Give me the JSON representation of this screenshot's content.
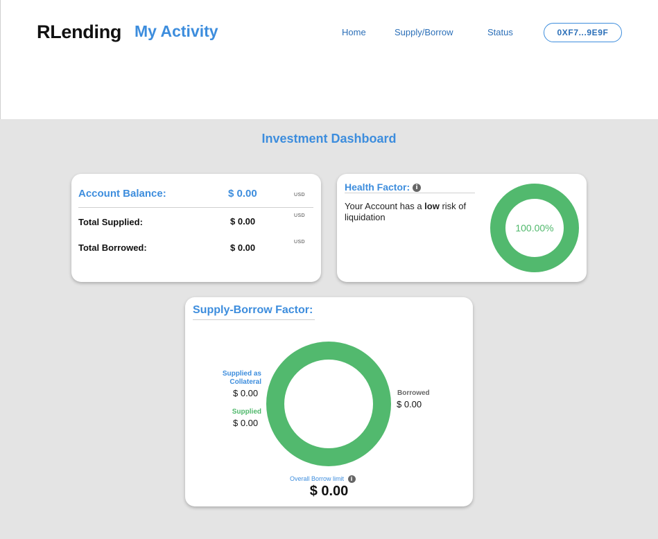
{
  "header": {
    "brand": "RLending",
    "section": "My Activity",
    "nav": {
      "home": "Home",
      "supply_borrow": "Supply/Borrow",
      "status": "Status"
    },
    "wallet": "0XF7...9E9F"
  },
  "dashboard": {
    "title": "Investment Dashboard",
    "account": {
      "balance_label": "Account Balance:",
      "balance_value": "$ 0.00",
      "currency": "USD",
      "supplied_label": "Total Supplied:",
      "supplied_value": "$ 0.00",
      "borrowed_label": "Total Borrowed:",
      "borrowed_value": "$ 0.00"
    },
    "health": {
      "title": "Health Factor:",
      "info_icon": "info-icon",
      "text_prefix": "Your Account has a ",
      "text_bold": "low",
      "text_suffix": " risk of liquidation",
      "percent": "100.00%",
      "fraction": 1.0,
      "color": "#52b96e"
    },
    "supply_borrow": {
      "title": "Supply-Borrow Factor:",
      "collateral_label": "Supplied as Collateral",
      "collateral_value": "$ 0.00",
      "supplied_label": "Supplied",
      "supplied_value": "$ 0.00",
      "borrowed_label": "Borrowed",
      "borrowed_value": "$ 0.00",
      "limit_label": "Overall Borrow limit",
      "limit_value": "$ 0.00",
      "ring_color": "#52b96e"
    }
  },
  "colors": {
    "accent": "#3d8ddd",
    "green": "#52b96e",
    "background": "#e4e4e4"
  }
}
